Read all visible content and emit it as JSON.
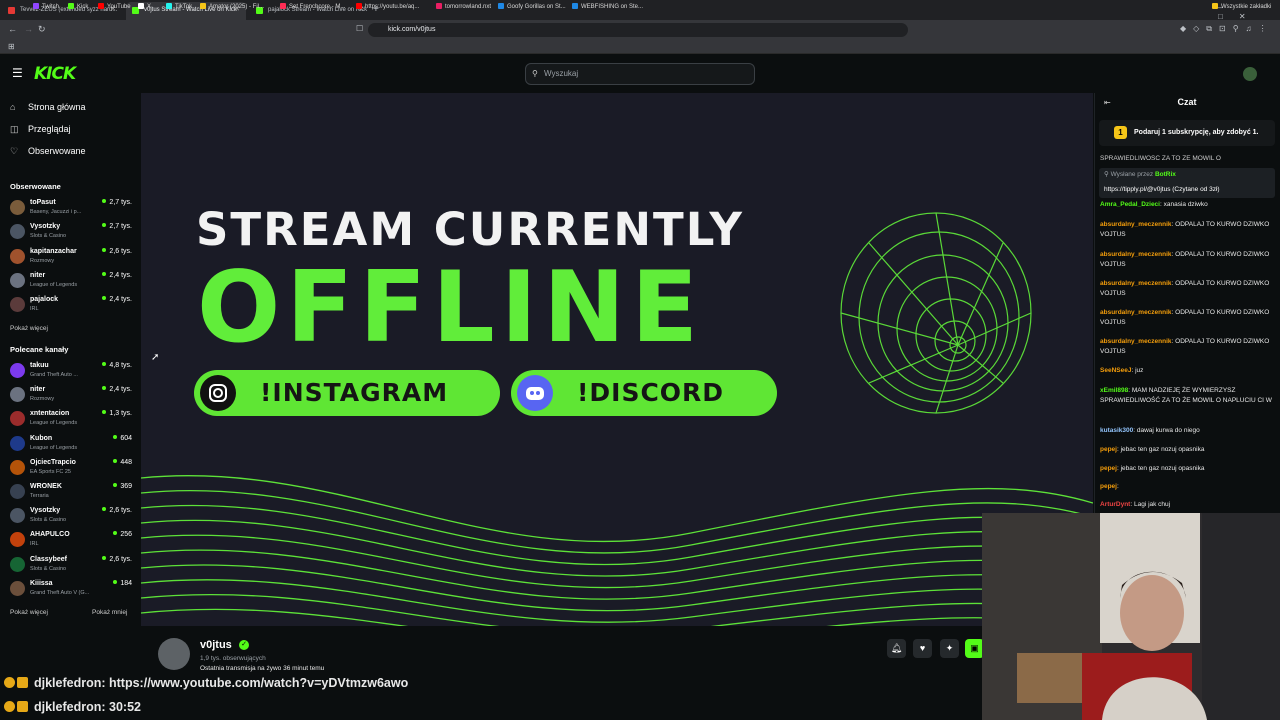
{
  "browser": {
    "tabs": [
      {
        "label": "Tevvez-ZEUS (extended syzz hard...",
        "color": "#e53935"
      },
      {
        "label": "v0jtus Stream - Watch Live on Kick",
        "color": "#53fc18"
      },
      {
        "label": "pajalock Stream - Watch Live on Kick",
        "color": "#53fc18"
      }
    ],
    "url": "kick.com/v0jtus",
    "bookmarks": [
      "Twitch",
      "Kick",
      "YouTube",
      "X",
      "TikTok",
      "Amator (2025) - Fil...",
      "Set Frenchcore - M...",
      "https://youtu.be/aq...",
      "tomorrowland.nxt",
      "Goofy Gorillas on St...",
      "WEBFISHING on Ste..."
    ],
    "all_bookmarks": "Wszystkie zakładki"
  },
  "kick": {
    "logo": "KICK",
    "search_placeholder": "Wyszukaj"
  },
  "sidebar": {
    "nav": [
      {
        "label": "Strona główna",
        "icon": "⌂"
      },
      {
        "label": "Przeglądaj",
        "icon": "◫"
      },
      {
        "label": "Obserwowane",
        "icon": "♡"
      }
    ],
    "followed_title": "Obserwowane",
    "followed": [
      {
        "name": "toPasut",
        "category": "Baseny, Jacuzzi i p...",
        "viewers": "2,7 tys.",
        "color": "#7a5c3b"
      },
      {
        "name": "Vysotzky",
        "category": "Slots & Casino",
        "viewers": "2,7 tys.",
        "color": "#4b5563"
      },
      {
        "name": "kapitanzachar",
        "category": "Rozmowy",
        "viewers": "2,6 tys.",
        "color": "#a0522d"
      },
      {
        "name": "niter",
        "category": "League of Legends",
        "viewers": "2,4 tys.",
        "color": "#6b7280"
      },
      {
        "name": "pajalock",
        "category": "IRL",
        "viewers": "2,4 tys.",
        "color": "#5b3b3b"
      }
    ],
    "followed_more": "Pokaż więcej",
    "recommended_title": "Polecane kanały",
    "recommended": [
      {
        "name": "takuu",
        "category": "Grand Theft Auto ...",
        "viewers": "4,8 tys.",
        "color": "#7c3aed"
      },
      {
        "name": "niter",
        "category": "Rozmowy",
        "viewers": "2,4 tys.",
        "color": "#6b7280"
      },
      {
        "name": "xntentacion",
        "category": "League of Legends",
        "viewers": "1,3 tys.",
        "color": "#9b2c2c"
      },
      {
        "name": "Kubon",
        "category": "League of Legends",
        "viewers": "604",
        "color": "#1e3a8a"
      },
      {
        "name": "OjciecTrapcio",
        "category": "EA Sports FC 25",
        "viewers": "448",
        "color": "#b45309"
      },
      {
        "name": "WRONEK",
        "category": "Terraria",
        "viewers": "369",
        "color": "#374151"
      },
      {
        "name": "Vysotzky",
        "category": "Slots & Casino",
        "viewers": "2,6 tys.",
        "color": "#4b5563"
      },
      {
        "name": "AHAPULCO",
        "category": "IRL",
        "viewers": "256",
        "color": "#c2410c"
      },
      {
        "name": "Classybeef",
        "category": "Slots & Casino",
        "viewers": "2,6 tys.",
        "color": "#166534"
      },
      {
        "name": "Kiiissa",
        "category": "Grand Theft Auto V (G...",
        "viewers": "184",
        "color": "#6b4f3b"
      }
    ],
    "recommended_more": "Pokaż więcej",
    "recommended_less": "Pokaż mniej"
  },
  "banner": {
    "line1": "STREAM CURRENTLY",
    "line2": "OFFLINE",
    "instagram": "!INSTAGRAM",
    "discord": "!DISCORD",
    "accent": "#5fe634"
  },
  "channel": {
    "name": "v0jtus",
    "followers": "1,9 tys. obserwujących",
    "last_live": "Ostatnia transmisja na żywo 36 minut temu",
    "actions": [
      "bell-icon",
      "heart-icon",
      "sparkle-icon",
      "gift-icon"
    ]
  },
  "chat": {
    "title": "Czat",
    "sub_prompt": "Podaruj 1 subskrypcję, aby zdobyć 1.",
    "clipped_top": "SPRAWIEDLIWOSC ZA TO ZE MOWIL O",
    "pinned_by": "Wysłane przez",
    "pinned_user": "BotRix",
    "pinned_text": "https://tipply.pl/@v0jtus (Czytane od 3zł)",
    "messages": [
      {
        "user": "Amra_Pedal_Dzieci",
        "color": "#53fc18",
        "text": "xanasia dziwko"
      },
      {
        "user": "absurdalny_meczennik",
        "color": "#f59e0b",
        "text": "ODPALAJ TO KURWO DZIWKO VOJTUS"
      },
      {
        "user": "absurdalny_meczennik",
        "color": "#f59e0b",
        "text": "ODPALAJ TO KURWO DZIWKO VOJTUS"
      },
      {
        "user": "absurdalny_meczennik",
        "color": "#f59e0b",
        "text": "ODPALAJ TO KURWO DZIWKO VOJTUS"
      },
      {
        "user": "absurdalny_meczennik",
        "color": "#f59e0b",
        "text": "ODPALAJ TO KURWO DZIWKO VOJTUS"
      },
      {
        "user": "absurdalny_meczennik",
        "color": "#f59e0b",
        "text": "ODPALAJ TO KURWO DZIWKO VOJTUS"
      },
      {
        "user": "SeeNSeeJ",
        "color": "#f59e0b",
        "text": "juz"
      },
      {
        "user": "xEmil898",
        "color": "#53fc18",
        "text": "MAM NADZIEJĘ ŻE WYMIERZYSZ SPRAWIEDLIWOŚĆ ZA TO ŻE MOWIL O NAPLUCIU CI W"
      },
      {
        "user": "kutasik300",
        "color": "#93c5fd",
        "text": "dawaj kurwa do niego"
      },
      {
        "user": "pepej",
        "color": "#f59e0b",
        "text": "jebac ten gaz nozuj opasnika"
      },
      {
        "user": "pepej",
        "color": "#f59e0b",
        "text": "jebac ten gaz nozuj opasnika"
      },
      {
        "user": "pepej",
        "color": "#f59e0b",
        "text": ""
      },
      {
        "user": "ArturDynt",
        "color": "#ef4444",
        "text": "Lagi jak chuj"
      }
    ]
  },
  "overlay": {
    "line1_user": "djklefedron",
    "line1_text": ": https://www.youtube.com/watch?v=yDVtmzw6awo",
    "line2_user": "djklefedron",
    "line2_text": ": 30:52"
  }
}
